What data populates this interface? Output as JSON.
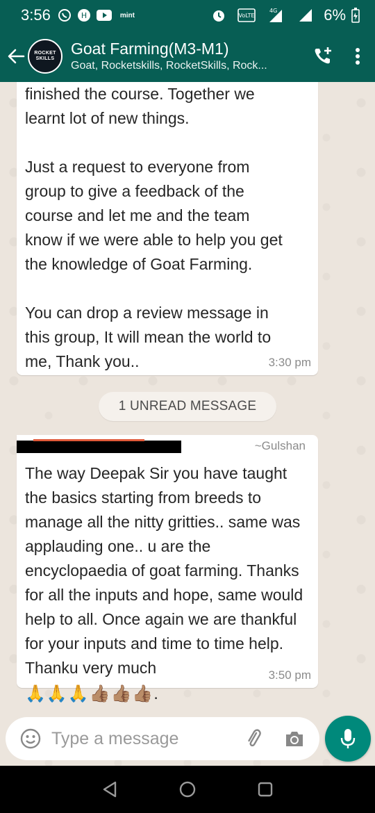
{
  "status_bar": {
    "time": "3:56",
    "app_label": "mint",
    "network": "4G",
    "volte": "VoLTE",
    "battery": "6%"
  },
  "header": {
    "title": "Goat Farming(M3-M1)",
    "subtitle": "Goat, Rocketskills, RocketSkills, Rock...",
    "avatar_line1": "ROCKET",
    "avatar_line2": "SKILLS",
    "add_call_icon": "add-call-icon",
    "menu_icon": "more-vert-icon"
  },
  "messages": [
    {
      "text": "finished the course. Together we\nlearnt lot of new things.\n\nJust a request to everyone from\ngroup to give a feedback of the\ncourse and let me and the team\nknow if we were able to help you get\nthe knowledge of Goat Farming.\n\nYou can drop a review message in\nthis group, It will mean the world to\nme, Thank you..",
      "time": "3:30 pm"
    },
    {
      "sender": "~Gulshan",
      "text": "The way Deepak Sir you have taught the basics starting from breeds to manage all the nitty gritties.. same was applauding one.. u are the encyclopaedia of goat farming. Thanks for all the inputs and hope, same would help to all. Once again we are thankful for your inputs and time to time help. Thanku very much",
      "emojis": "🙏🙏🙏👍🏽👍🏽👍🏽.",
      "time": "3:50 pm"
    }
  ],
  "unread_divider": "1 UNREAD MESSAGE",
  "composer": {
    "placeholder": "Type a message"
  },
  "colors": {
    "header": "#075e54",
    "mic_button": "#00897b",
    "chat_background": "#ece5dd"
  }
}
